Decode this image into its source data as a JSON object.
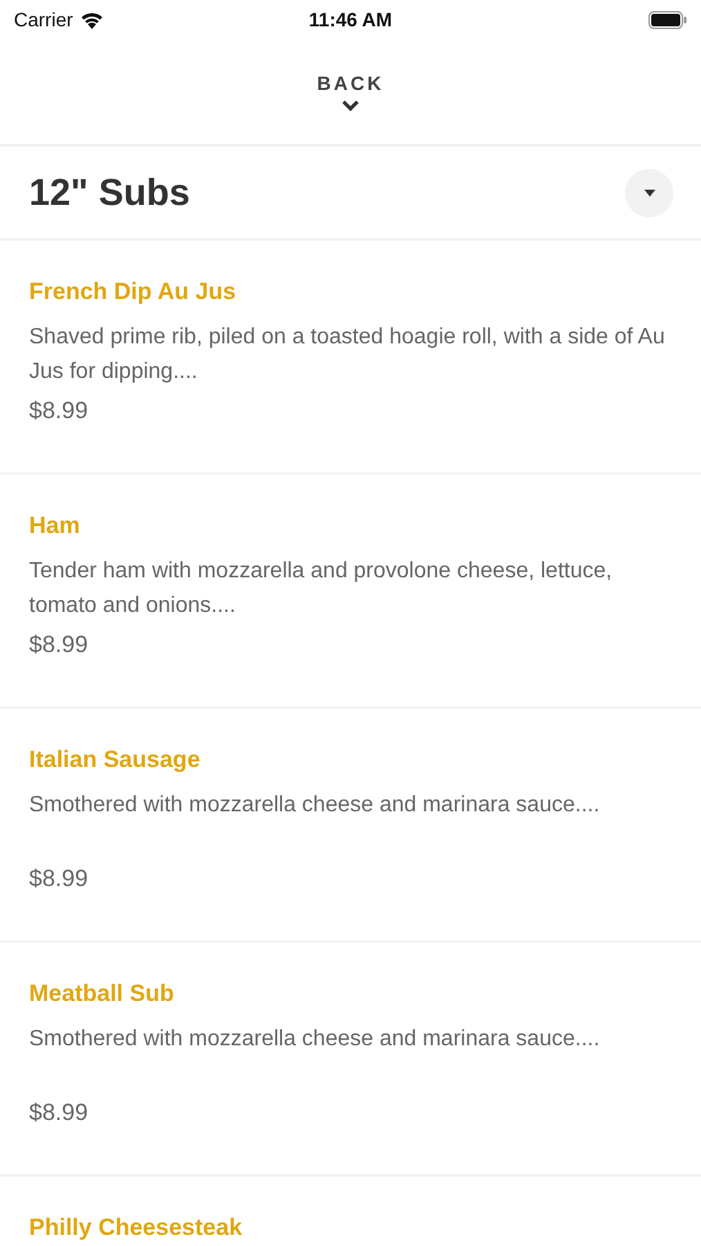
{
  "status_bar": {
    "carrier": "Carrier",
    "time": "11:46 AM"
  },
  "nav": {
    "back_label": "BACK"
  },
  "category": {
    "title": "12\" Subs"
  },
  "items": [
    {
      "name": "French Dip Au Jus",
      "description": "Shaved prime rib, piled on a toasted hoagie roll, with a side of Au Jus for dipping....",
      "price": "$8.99"
    },
    {
      "name": "Ham",
      "description": "Tender ham with mozzarella and provolone cheese, lettuce, tomato and onions....",
      "price": "$8.99"
    },
    {
      "name": "Italian Sausage",
      "description": "Smothered with mozzarella cheese and marinara sauce....",
      "price": "$8.99"
    },
    {
      "name": "Meatball Sub",
      "description": "Smothered with mozzarella cheese and marinara sauce....",
      "price": "$8.99"
    },
    {
      "name": "Philly Cheesesteak"
    }
  ]
}
